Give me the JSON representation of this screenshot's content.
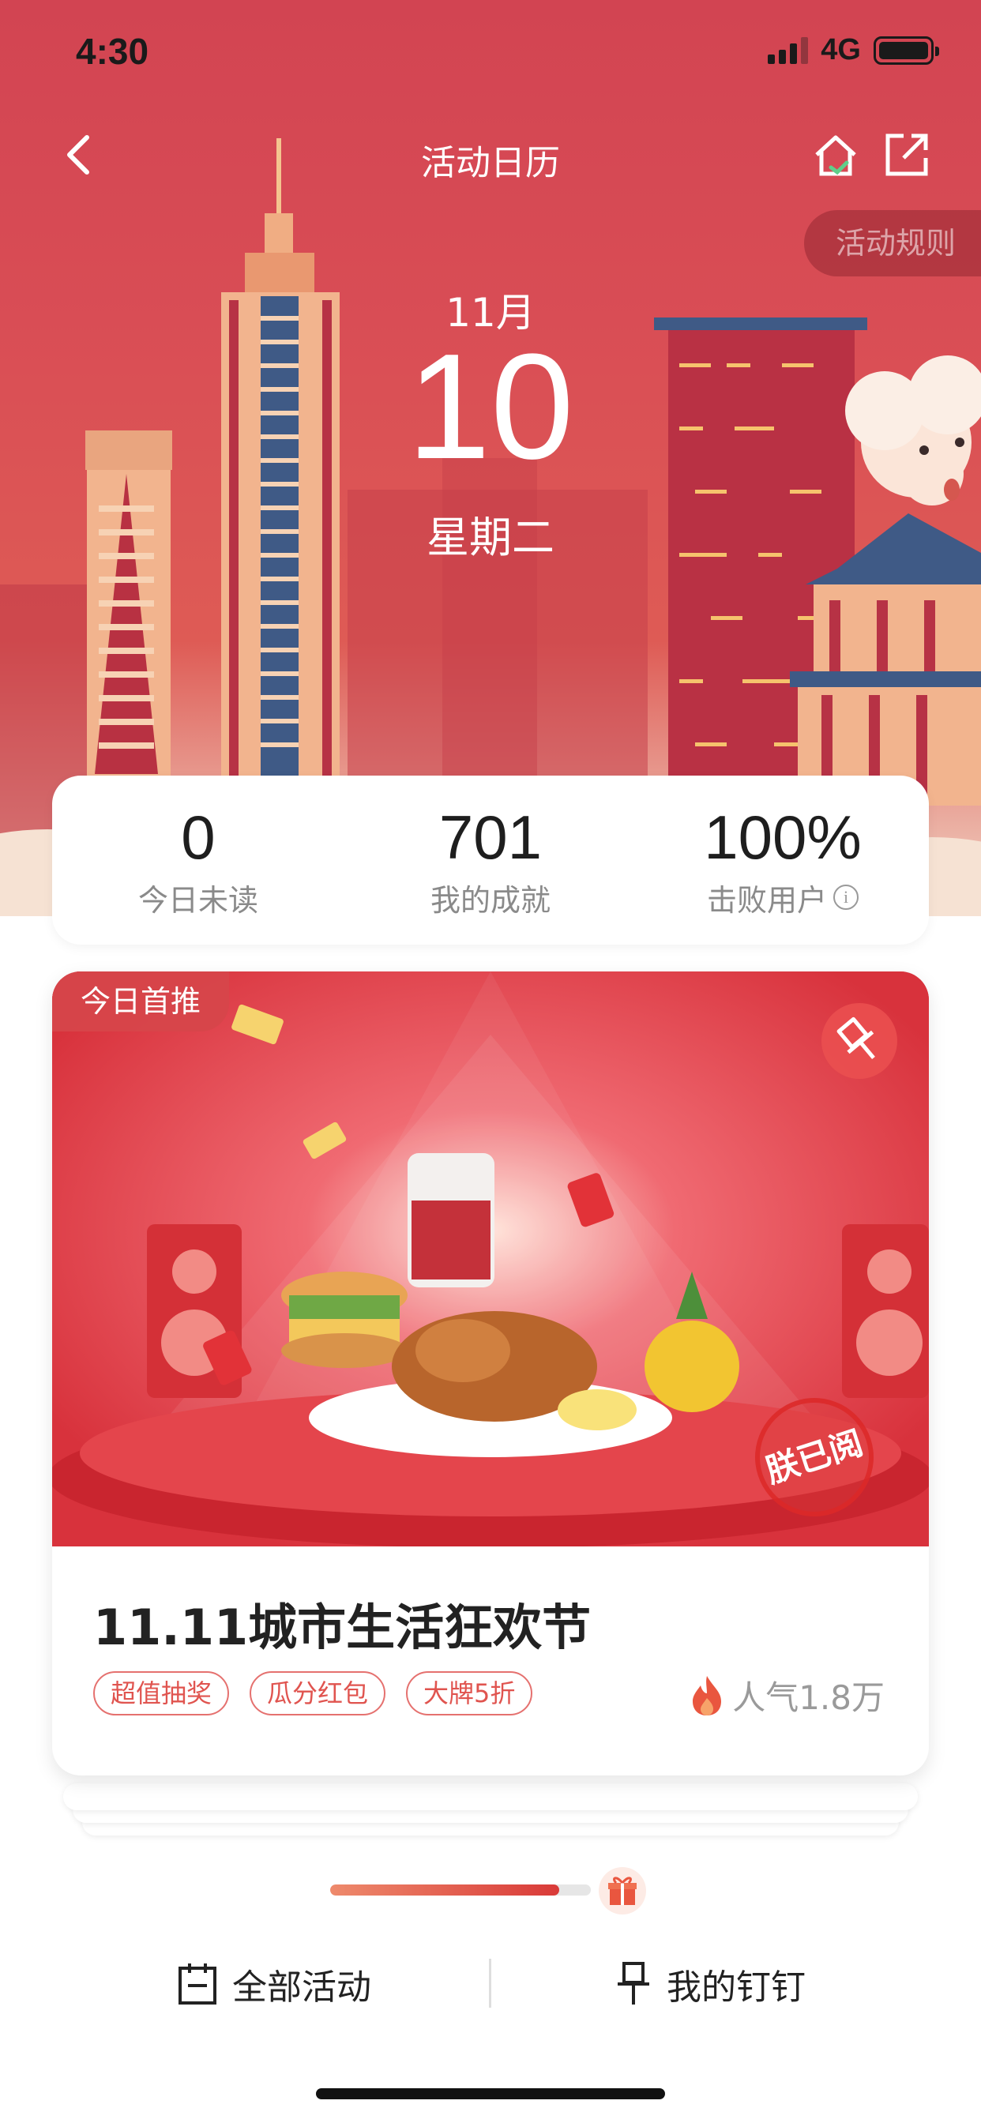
{
  "status_bar": {
    "time": "4:30",
    "network": "4G"
  },
  "nav": {
    "title": "活动日历"
  },
  "rules_button": {
    "label": "活动规则"
  },
  "date": {
    "month": "11月",
    "day": "10",
    "weekday": "星期二"
  },
  "stats": [
    {
      "value": "0",
      "label": "今日未读"
    },
    {
      "value": "701",
      "label": "我的成就"
    },
    {
      "value": "100%",
      "label": "击败用户"
    }
  ],
  "feature": {
    "badge": "今日首推",
    "stamp": "朕已阅",
    "title": "11.11城市生活狂欢节",
    "tags": [
      "超值抽奖",
      "瓜分红包",
      "大牌5折"
    ],
    "popularity": "人气1.8万"
  },
  "progress": {
    "value": 0.88
  },
  "bottom_bar": {
    "all_activities": "全部活动",
    "my_pins": "我的钉钉"
  },
  "colors": {
    "hero_red": "#d24452",
    "accent": "#e0544f",
    "text": "#222222"
  }
}
